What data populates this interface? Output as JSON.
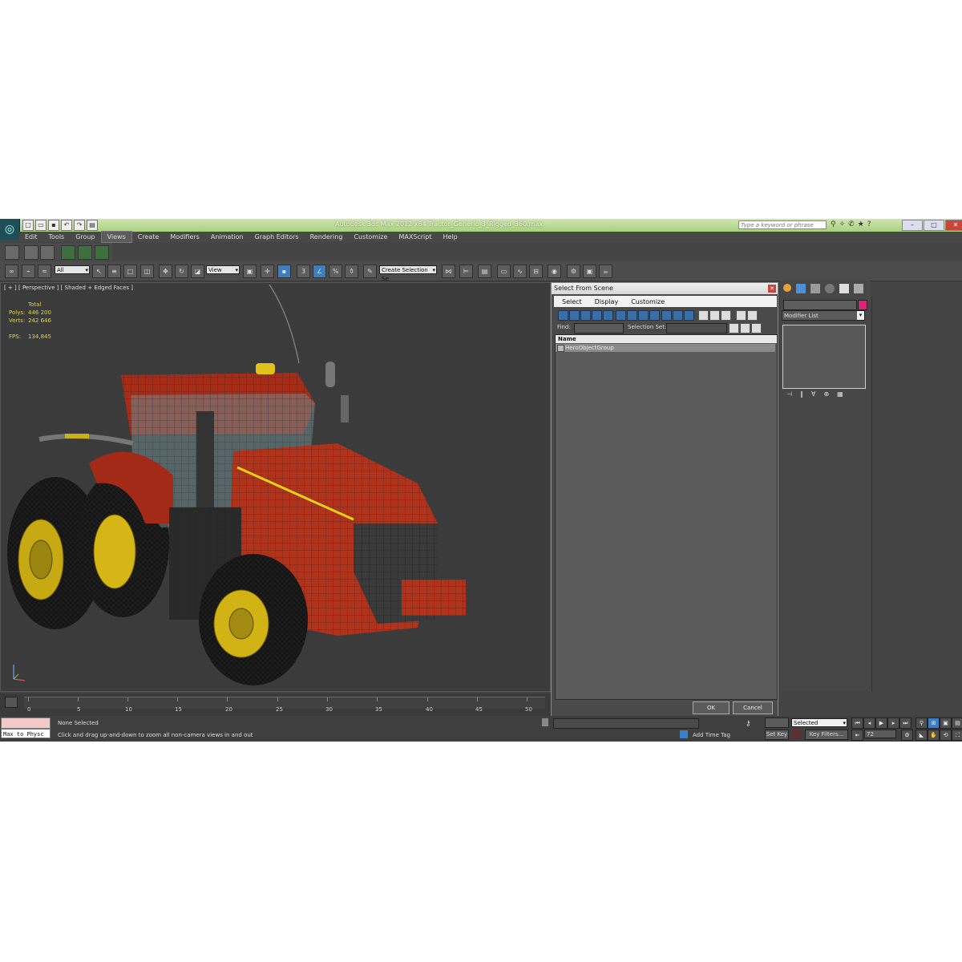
{
  "window": {
    "title": "Autodesk 3ds Max  2012 x64      Tractor_Generic_3_Rigged_360.max",
    "search_placeholder": "Type a keyword or phrase"
  },
  "menu": [
    "Edit",
    "Tools",
    "Group",
    "Views",
    "Create",
    "Modifiers",
    "Animation",
    "Graph Editors",
    "Rendering",
    "Customize",
    "MAXScript",
    "Help"
  ],
  "menu_active": "Views",
  "toolbar": {
    "filter_value": "All",
    "ref_coord_value": "View",
    "named_selection_placeholder": "Create Selection Se",
    "snap_label": "3"
  },
  "viewport": {
    "label": "[ + ] [ Perspective ] [ Shaded + Edged Faces ]",
    "stats": {
      "header": "Total",
      "polys_label": "Polys:",
      "polys_value": "446 200",
      "verts_label": "Verts:",
      "verts_value": "242 646",
      "fps_label": "FPS:",
      "fps_value": "134,845"
    }
  },
  "dialog": {
    "title": "Select From Scene",
    "menu": [
      "Select",
      "Display",
      "Customize"
    ],
    "find_label": "Find:",
    "selection_set_label": "Selection Set:",
    "column_name": "Name",
    "items": [
      "HeroObjectGroup"
    ],
    "ok_label": "OK",
    "cancel_label": "Cancel"
  },
  "command_panel": {
    "modifier_list": "Modifier List",
    "accent_color": "#d9227a"
  },
  "timeline": {
    "ticks": [
      "0",
      "5",
      "10",
      "15",
      "20",
      "25",
      "30",
      "35",
      "40",
      "45",
      "50"
    ]
  },
  "status": {
    "maxscript_text": "Max to Physc",
    "selection_status": "None Selected",
    "prompt": "Click and drag up-and-down to zoom all non-camera views in and out",
    "add_time_tag": "Add Time Tag",
    "set_key": "Set Key",
    "key_filters": "Key Filters...",
    "auto_key_mode": "Selected",
    "current_frame": "72"
  }
}
